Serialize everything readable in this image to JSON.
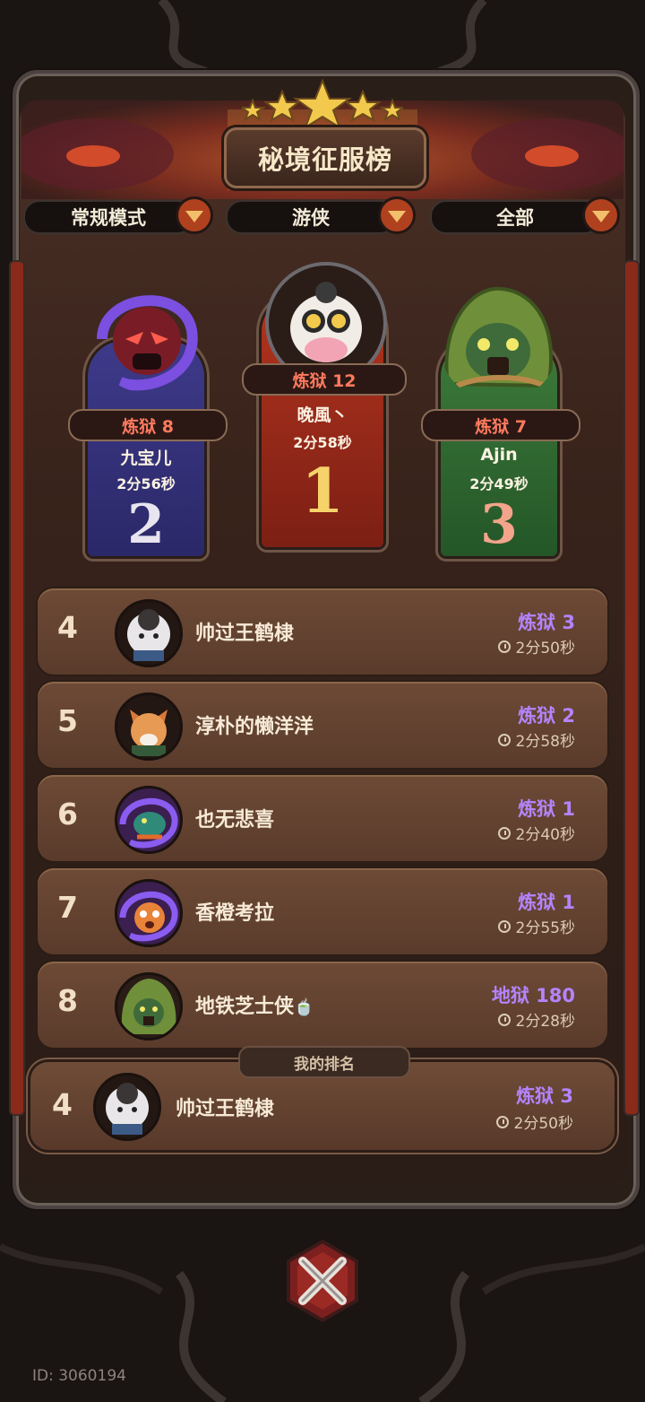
{
  "title": "秘境征服榜",
  "filters": [
    {
      "label": "常规模式"
    },
    {
      "label": "游侠"
    },
    {
      "label": "全部"
    }
  ],
  "podium": {
    "first": {
      "difficulty": "炼狱 12",
      "name": "晚風丶",
      "time": "2分58秒",
      "place": "1",
      "avatar": "cow-goggles-icon"
    },
    "second": {
      "difficulty": "炼狱 8",
      "name": "九宝儿",
      "time": "2分56秒",
      "place": "2",
      "avatar": "dark-fiend-icon"
    },
    "third": {
      "difficulty": "炼狱 7",
      "name": "Ajin",
      "time": "2分49秒",
      "place": "3",
      "avatar": "hooded-frog-icon"
    }
  },
  "ranking": [
    {
      "rank": "4",
      "name": "帅过王鹤棣",
      "difficulty": "炼狱 3",
      "time": "2分50秒",
      "avatar": "sheep-icon"
    },
    {
      "rank": "5",
      "name": "淳朴的懒洋洋",
      "difficulty": "炼狱 2",
      "time": "2分58秒",
      "avatar": "fox-icon"
    },
    {
      "rank": "6",
      "name": "也无悲喜",
      "difficulty": "炼狱 1",
      "time": "2分40秒",
      "avatar": "dragon-icon"
    },
    {
      "rank": "7",
      "name": "香橙考拉",
      "difficulty": "炼狱 1",
      "time": "2分55秒",
      "avatar": "tiger-icon"
    },
    {
      "rank": "8",
      "name": "地铁芝士侠",
      "difficulty": "地狱 180",
      "time": "2分28秒",
      "avatar": "hooded-frog-icon",
      "badge": "🍵"
    }
  ],
  "my_rank": {
    "tab": "我的排名",
    "rank": "4",
    "name": "帅过王鹤棣",
    "difficulty": "炼狱 3",
    "time": "2分50秒"
  },
  "footer": {
    "id": "ID: 3060194"
  },
  "colors": {
    "accent_red": "#b0411f",
    "difficulty_purple": "#b484ff",
    "gold": "#f2c94c"
  }
}
